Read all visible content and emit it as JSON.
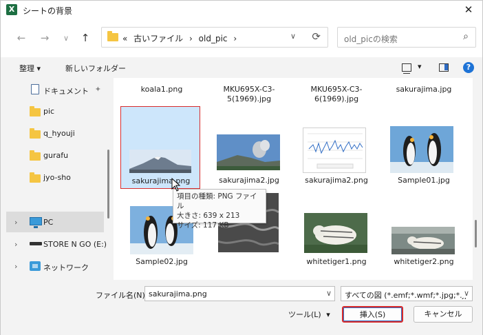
{
  "window": {
    "title": "シートの背景",
    "app_logo": "X"
  },
  "nav": {
    "back": "←",
    "forward": "→",
    "recent": "∨",
    "up": "↑",
    "address": [
      "«",
      "古いファイル",
      "›",
      "old_pic",
      "›"
    ],
    "address_dd": "∨",
    "refresh": "⟳",
    "search_placeholder": "old_picの検索",
    "search_icon": "⌕"
  },
  "toolbar": {
    "organize": "整理 ▾",
    "new_folder": "新しいフォルダー",
    "view_dd": "▾",
    "help": "?"
  },
  "sidebar": [
    {
      "label": "ドキュメント",
      "icon": "document-icon",
      "pinned": true
    },
    {
      "label": "pic",
      "icon": "folder-icon"
    },
    {
      "label": "q_hyouji",
      "icon": "folder-icon"
    },
    {
      "label": "gurafu",
      "icon": "folder-icon"
    },
    {
      "label": "jyo-sho",
      "icon": "folder-icon"
    },
    {
      "label": "PC",
      "icon": "pc-icon",
      "expander": "›",
      "selected": true
    },
    {
      "label": "STORE N GO (E:)",
      "icon": "drive-icon",
      "expander": "›"
    },
    {
      "label": "ネットワーク",
      "icon": "network-icon",
      "expander": "›"
    }
  ],
  "pin": "✦",
  "files": [
    {
      "name": "koala1.png"
    },
    {
      "name": "MKU695X-C3-5(1969).jpg"
    },
    {
      "name": "MKU695X-C3-6(1969).jpg"
    },
    {
      "name": "sakurajima.jpg"
    },
    {
      "name": "sakurajima.png",
      "selected": true
    },
    {
      "name": "sakurajima2.jpg"
    },
    {
      "name": "sakurajima2.png"
    },
    {
      "name": "Sample01.jpg"
    },
    {
      "name": "Sample02.jpg"
    },
    {
      "name": ""
    },
    {
      "name": "whitetiger1.png"
    },
    {
      "name": "whitetiger2.png"
    }
  ],
  "tooltip": {
    "line1": "項目の種類: PNG ファイル",
    "line2": "大きさ: 639 x 213",
    "line3": "サイズ: 117 KB"
  },
  "bottom": {
    "filename_label": "ファイル名(N):",
    "filename_value": "sakurajima.png",
    "filetype_value": "すべての図 (*.emf;*.wmf;*.jpg;*.jp",
    "dd": "∨",
    "tools": "ツール(L)",
    "tools_dd": "▾",
    "insert": "挿入(S)",
    "cancel": "キャンセル"
  },
  "colors": {
    "accent": "#2f6cc4",
    "highlight": "#d92b2b",
    "select": "#cde6fb"
  }
}
